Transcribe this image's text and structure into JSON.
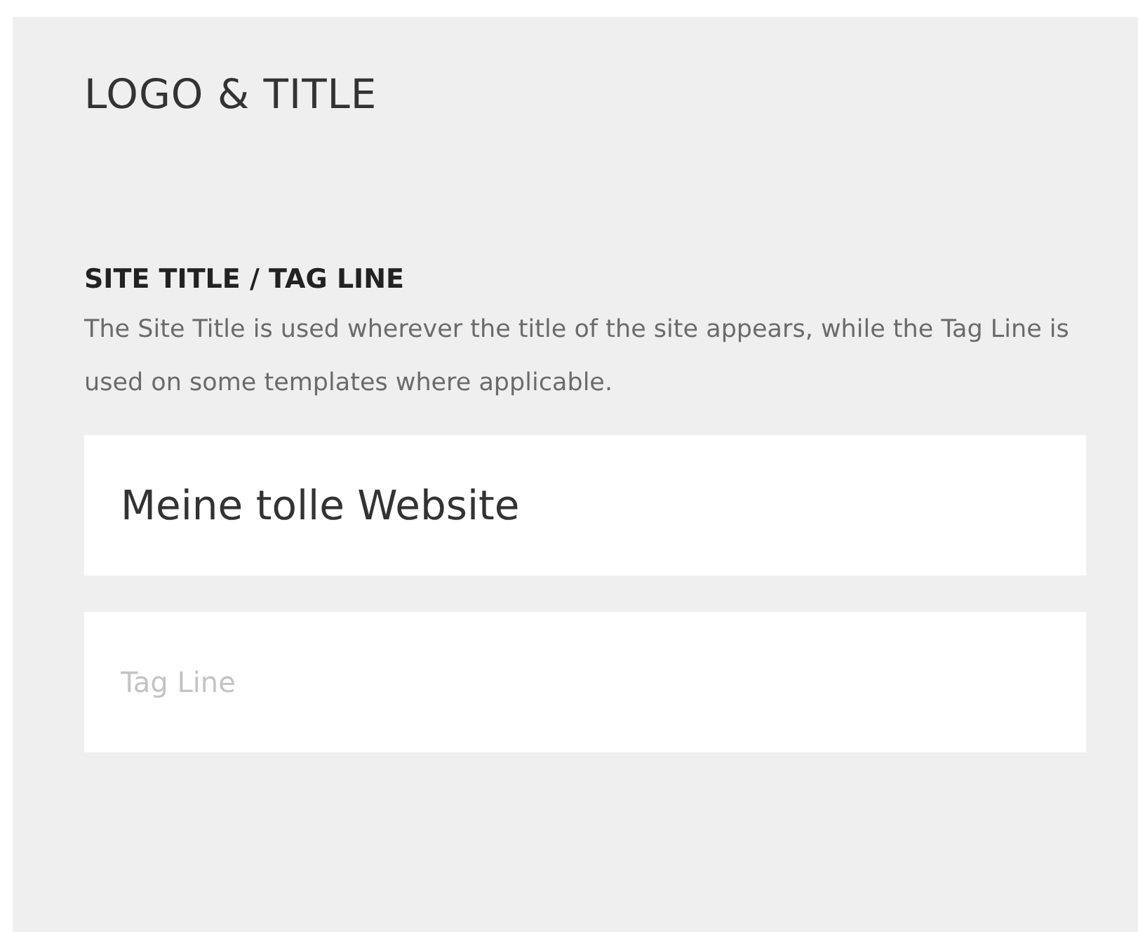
{
  "panel": {
    "title": "LOGO & TITLE"
  },
  "section": {
    "heading": "SITE TITLE / TAG LINE",
    "description": "The Site Title is used wherever the title of the site appears, while the Tag Line is used on some templates where applicable."
  },
  "fields": [
    {
      "kind": "value",
      "value": "Meine tolle Website"
    },
    {
      "kind": "placeholder",
      "placeholder": "Tag Line"
    }
  ]
}
